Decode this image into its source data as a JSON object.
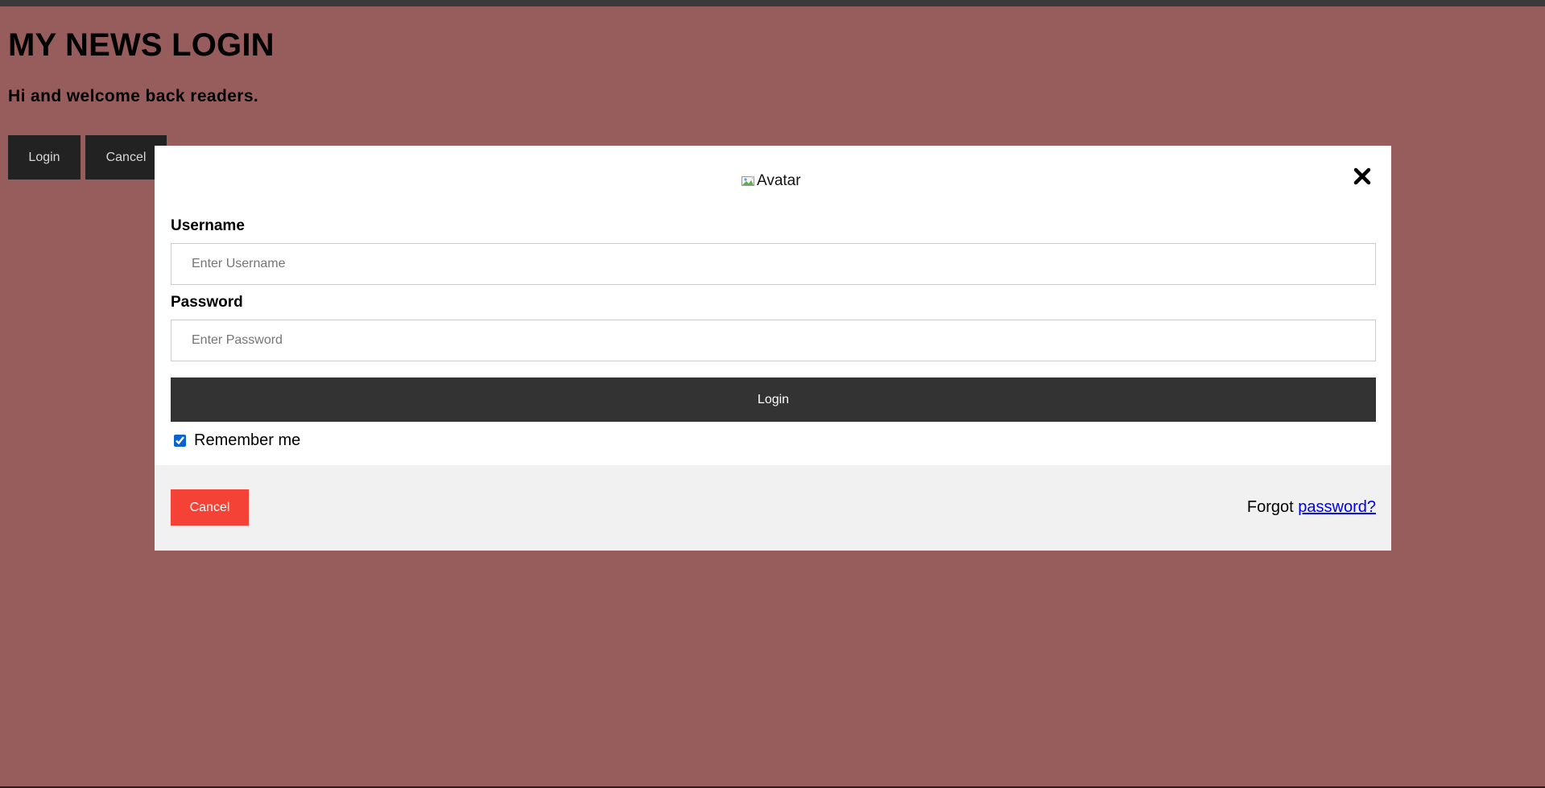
{
  "page": {
    "title": "MY NEWS LOGIN",
    "subtitle": "Hi and welcome back readers.",
    "login_button": "Login",
    "cancel_button": "Cancel"
  },
  "modal": {
    "avatar_alt": "Avatar",
    "close_icon": "close-x-icon",
    "username_label": "Username",
    "username_placeholder": "Enter Username",
    "username_value": "",
    "password_label": "Password",
    "password_placeholder": "Enter Password",
    "password_value": "",
    "submit_label": "Login",
    "remember_label": "Remember me",
    "remember_checked": true,
    "cancel_label": "Cancel",
    "forgot_prefix": "Forgot",
    "forgot_link": "password?"
  },
  "colors": {
    "page_background": "#975d5c",
    "dark_button": "#222222",
    "submit_button": "#333333",
    "cancel_button": "#f44336",
    "footer_background": "#f1f1f1",
    "link": "#0000ee"
  }
}
